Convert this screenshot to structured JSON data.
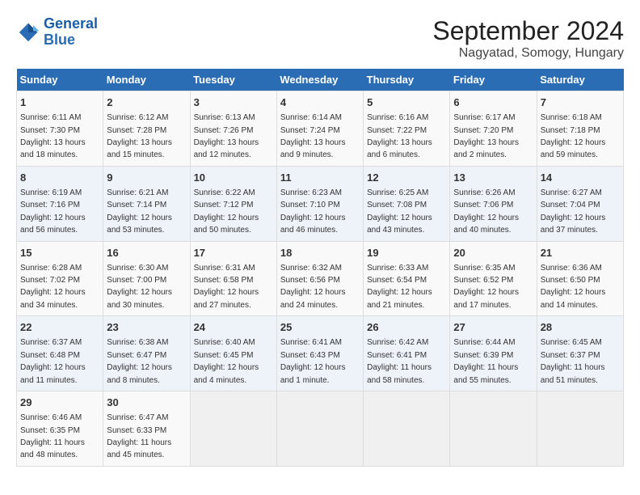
{
  "header": {
    "logo_line1": "General",
    "logo_line2": "Blue",
    "main_title": "September 2024",
    "subtitle": "Nagyatad, Somogy, Hungary"
  },
  "weekdays": [
    "Sunday",
    "Monday",
    "Tuesday",
    "Wednesday",
    "Thursday",
    "Friday",
    "Saturday"
  ],
  "weeks": [
    [
      {
        "day": "1",
        "info": "Sunrise: 6:11 AM\nSunset: 7:30 PM\nDaylight: 13 hours and 18 minutes."
      },
      {
        "day": "2",
        "info": "Sunrise: 6:12 AM\nSunset: 7:28 PM\nDaylight: 13 hours and 15 minutes."
      },
      {
        "day": "3",
        "info": "Sunrise: 6:13 AM\nSunset: 7:26 PM\nDaylight: 13 hours and 12 minutes."
      },
      {
        "day": "4",
        "info": "Sunrise: 6:14 AM\nSunset: 7:24 PM\nDaylight: 13 hours and 9 minutes."
      },
      {
        "day": "5",
        "info": "Sunrise: 6:16 AM\nSunset: 7:22 PM\nDaylight: 13 hours and 6 minutes."
      },
      {
        "day": "6",
        "info": "Sunrise: 6:17 AM\nSunset: 7:20 PM\nDaylight: 13 hours and 2 minutes."
      },
      {
        "day": "7",
        "info": "Sunrise: 6:18 AM\nSunset: 7:18 PM\nDaylight: 12 hours and 59 minutes."
      }
    ],
    [
      {
        "day": "8",
        "info": "Sunrise: 6:19 AM\nSunset: 7:16 PM\nDaylight: 12 hours and 56 minutes."
      },
      {
        "day": "9",
        "info": "Sunrise: 6:21 AM\nSunset: 7:14 PM\nDaylight: 12 hours and 53 minutes."
      },
      {
        "day": "10",
        "info": "Sunrise: 6:22 AM\nSunset: 7:12 PM\nDaylight: 12 hours and 50 minutes."
      },
      {
        "day": "11",
        "info": "Sunrise: 6:23 AM\nSunset: 7:10 PM\nDaylight: 12 hours and 46 minutes."
      },
      {
        "day": "12",
        "info": "Sunrise: 6:25 AM\nSunset: 7:08 PM\nDaylight: 12 hours and 43 minutes."
      },
      {
        "day": "13",
        "info": "Sunrise: 6:26 AM\nSunset: 7:06 PM\nDaylight: 12 hours and 40 minutes."
      },
      {
        "day": "14",
        "info": "Sunrise: 6:27 AM\nSunset: 7:04 PM\nDaylight: 12 hours and 37 minutes."
      }
    ],
    [
      {
        "day": "15",
        "info": "Sunrise: 6:28 AM\nSunset: 7:02 PM\nDaylight: 12 hours and 34 minutes."
      },
      {
        "day": "16",
        "info": "Sunrise: 6:30 AM\nSunset: 7:00 PM\nDaylight: 12 hours and 30 minutes."
      },
      {
        "day": "17",
        "info": "Sunrise: 6:31 AM\nSunset: 6:58 PM\nDaylight: 12 hours and 27 minutes."
      },
      {
        "day": "18",
        "info": "Sunrise: 6:32 AM\nSunset: 6:56 PM\nDaylight: 12 hours and 24 minutes."
      },
      {
        "day": "19",
        "info": "Sunrise: 6:33 AM\nSunset: 6:54 PM\nDaylight: 12 hours and 21 minutes."
      },
      {
        "day": "20",
        "info": "Sunrise: 6:35 AM\nSunset: 6:52 PM\nDaylight: 12 hours and 17 minutes."
      },
      {
        "day": "21",
        "info": "Sunrise: 6:36 AM\nSunset: 6:50 PM\nDaylight: 12 hours and 14 minutes."
      }
    ],
    [
      {
        "day": "22",
        "info": "Sunrise: 6:37 AM\nSunset: 6:48 PM\nDaylight: 12 hours and 11 minutes."
      },
      {
        "day": "23",
        "info": "Sunrise: 6:38 AM\nSunset: 6:47 PM\nDaylight: 12 hours and 8 minutes."
      },
      {
        "day": "24",
        "info": "Sunrise: 6:40 AM\nSunset: 6:45 PM\nDaylight: 12 hours and 4 minutes."
      },
      {
        "day": "25",
        "info": "Sunrise: 6:41 AM\nSunset: 6:43 PM\nDaylight: 12 hours and 1 minute."
      },
      {
        "day": "26",
        "info": "Sunrise: 6:42 AM\nSunset: 6:41 PM\nDaylight: 11 hours and 58 minutes."
      },
      {
        "day": "27",
        "info": "Sunrise: 6:44 AM\nSunset: 6:39 PM\nDaylight: 11 hours and 55 minutes."
      },
      {
        "day": "28",
        "info": "Sunrise: 6:45 AM\nSunset: 6:37 PM\nDaylight: 11 hours and 51 minutes."
      }
    ],
    [
      {
        "day": "29",
        "info": "Sunrise: 6:46 AM\nSunset: 6:35 PM\nDaylight: 11 hours and 48 minutes."
      },
      {
        "day": "30",
        "info": "Sunrise: 6:47 AM\nSunset: 6:33 PM\nDaylight: 11 hours and 45 minutes."
      },
      {
        "day": "",
        "info": ""
      },
      {
        "day": "",
        "info": ""
      },
      {
        "day": "",
        "info": ""
      },
      {
        "day": "",
        "info": ""
      },
      {
        "day": "",
        "info": ""
      }
    ]
  ]
}
